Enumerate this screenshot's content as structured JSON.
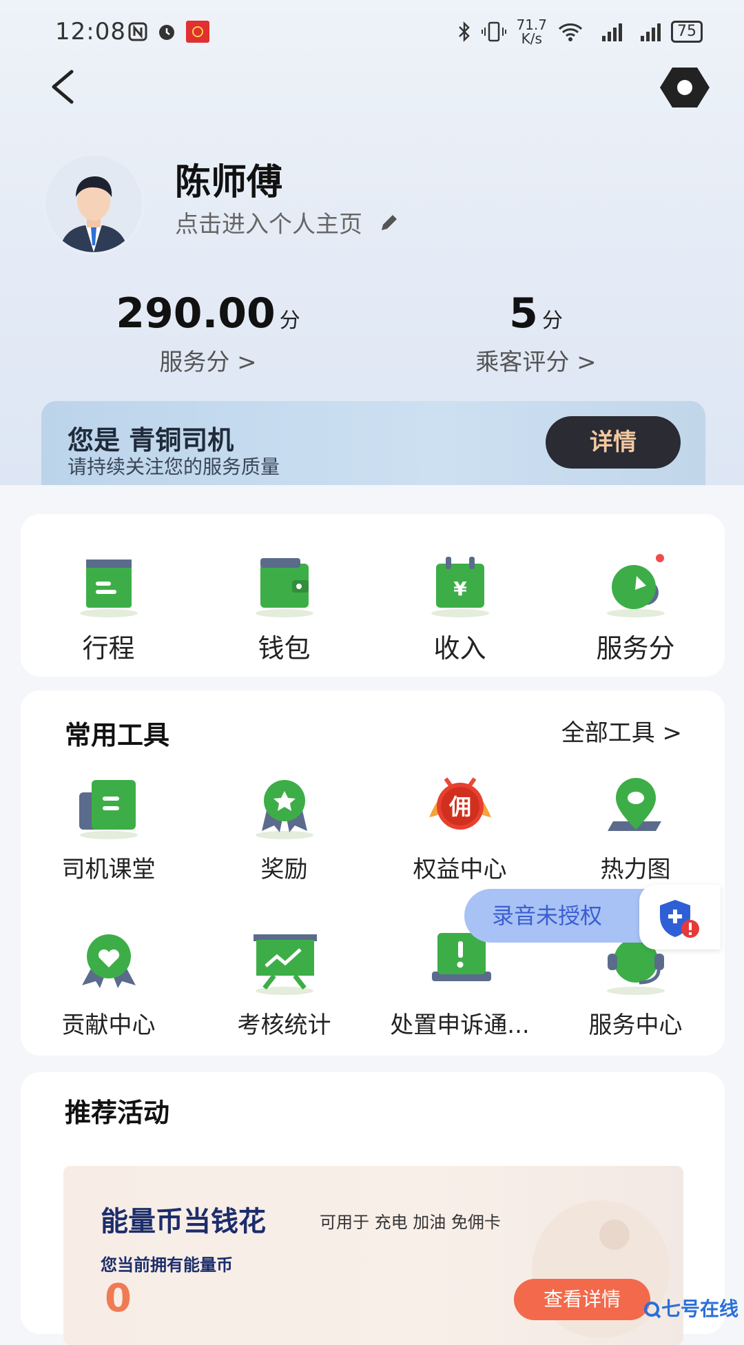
{
  "status_bar": {
    "time": "12:08",
    "net_speed_value": "71.7",
    "net_speed_unit": "K/s",
    "battery": "75"
  },
  "profile": {
    "name": "陈师傅",
    "link_text": "点击进入个人主页"
  },
  "stats": [
    {
      "value": "290.00",
      "unit": "分",
      "label": "服务分 >"
    },
    {
      "value": "5",
      "unit": "分",
      "label": "乘客评分 >"
    }
  ],
  "level_banner": {
    "title": "您是 青铜司机",
    "subtitle": "请持续关注您的服务质量",
    "button": "详情"
  },
  "quick_actions": [
    {
      "label": "行程",
      "icon": "trip-icon"
    },
    {
      "label": "钱包",
      "icon": "wallet-icon"
    },
    {
      "label": "收入",
      "icon": "income-icon"
    },
    {
      "label": "服务分",
      "icon": "service-score-icon"
    }
  ],
  "tools": {
    "title": "常用工具",
    "all_link": "全部工具 >",
    "items": [
      {
        "label": "司机课堂",
        "icon": "driver-class-icon"
      },
      {
        "label": "奖励",
        "icon": "reward-icon"
      },
      {
        "label": "权益中心",
        "icon": "commission-badge-icon",
        "badge_text": "佣"
      },
      {
        "label": "热力图",
        "icon": "heatmap-pin-icon"
      },
      {
        "label": "贡献中心",
        "icon": "contribution-heart-icon"
      },
      {
        "label": "考核统计",
        "icon": "assessment-chart-icon"
      },
      {
        "label": "处置申诉通...",
        "icon": "appeal-alert-icon"
      },
      {
        "label": "服务中心",
        "icon": "service-headset-icon"
      }
    ]
  },
  "recording": {
    "label": "录音未授权"
  },
  "activities": {
    "title": "推荐活动",
    "banner": {
      "title": "能量币当钱花",
      "subtitle": "可用于 充电 加油 免佣卡",
      "label": "您当前拥有能量币",
      "value": "0",
      "button": "查看详情"
    }
  },
  "watermark": "七号在线",
  "colors": {
    "green": "#3dae47",
    "dark_pill": "#2a2b33",
    "accent_orange": "#f26a4b",
    "rec_pill": "#a9c2f5"
  }
}
